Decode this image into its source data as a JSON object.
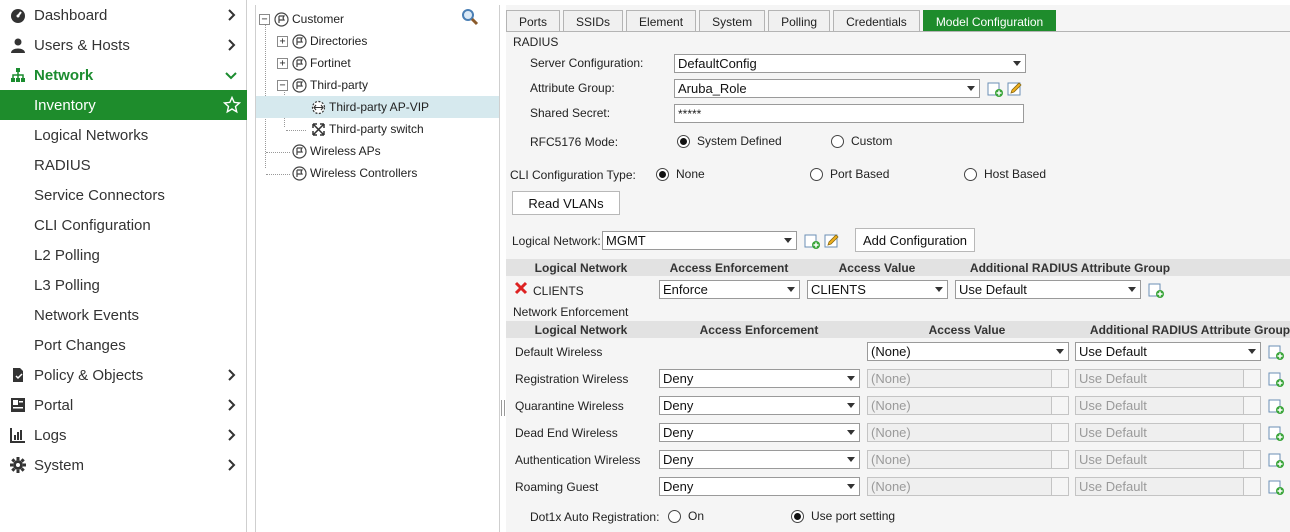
{
  "sidebar": {
    "items": [
      {
        "label": "Dashboard",
        "icon": "dashboard-icon"
      },
      {
        "label": "Users & Hosts",
        "icon": "user-icon"
      },
      {
        "label": "Network",
        "icon": "network-icon"
      },
      {
        "label": "Inventory"
      },
      {
        "label": "Logical Networks"
      },
      {
        "label": "RADIUS"
      },
      {
        "label": "Service Connectors"
      },
      {
        "label": "CLI Configuration"
      },
      {
        "label": "L2 Polling"
      },
      {
        "label": "L3 Polling"
      },
      {
        "label": "Network Events"
      },
      {
        "label": "Port Changes"
      },
      {
        "label": "Policy & Objects",
        "icon": "policy-icon"
      },
      {
        "label": "Portal",
        "icon": "portal-icon"
      },
      {
        "label": "Logs",
        "icon": "logs-icon"
      },
      {
        "label": "System",
        "icon": "gear-icon"
      }
    ]
  },
  "tree": {
    "root": "Customer",
    "nodes": [
      "Directories",
      "Fortinet",
      "Third-party",
      "Third-party AP-VIP",
      "Third-party switch",
      "Wireless APs",
      "Wireless Controllers"
    ]
  },
  "tabs": [
    "Ports",
    "SSIDs",
    "Element",
    "System",
    "Polling",
    "Credentials",
    "Model Configuration"
  ],
  "radius": {
    "title": "RADIUS",
    "server_config_label": "Server Configuration:",
    "server_config_value": "DefaultConfig",
    "attr_group_label": "Attribute Group:",
    "attr_group_value": "Aruba_Role",
    "shared_secret_label": "Shared Secret:",
    "shared_secret_value": "*****",
    "rfc_label": "RFC5176 Mode:",
    "rfc_opt1": "System Defined",
    "rfc_opt2": "Custom"
  },
  "cli": {
    "label": "CLI Configuration Type:",
    "opt1": "None",
    "opt2": "Port Based",
    "opt3": "Host Based"
  },
  "read_vlans": "Read VLANs",
  "logical_network": {
    "label": "Logical Network:",
    "value": "MGMT",
    "add_button": "Add Configuration"
  },
  "table1": {
    "headers": [
      "Logical Network",
      "Access Enforcement",
      "Access Value",
      "Additional RADIUS Attribute Group"
    ],
    "rows": [
      {
        "network": "CLIENTS",
        "enforcement": "Enforce",
        "value": "CLIENTS",
        "group": "Use Default"
      }
    ]
  },
  "net_enforcement": {
    "title": "Network Enforcement",
    "headers": [
      "Logical Network",
      "Access Enforcement",
      "Access Value",
      "Additional RADIUS Attribute Group"
    ],
    "rows": [
      {
        "network": "Default Wireless",
        "enforcement": "",
        "value": "(None)",
        "group": "Use Default"
      },
      {
        "network": "Registration Wireless",
        "enforcement": "Deny",
        "value": "(None)",
        "group": "Use Default"
      },
      {
        "network": "Quarantine Wireless",
        "enforcement": "Deny",
        "value": "(None)",
        "group": "Use Default"
      },
      {
        "network": "Dead End Wireless",
        "enforcement": "Deny",
        "value": "(None)",
        "group": "Use Default"
      },
      {
        "network": "Authentication Wireless",
        "enforcement": "Deny",
        "value": "(None)",
        "group": "Use Default"
      },
      {
        "network": "Roaming Guest",
        "enforcement": "Deny",
        "value": "(None)",
        "group": "Use Default"
      }
    ]
  },
  "dot1x": {
    "label": "Dot1x Auto Registration:",
    "opt1": "On",
    "opt2": "Use port setting"
  },
  "colors": {
    "accent": "#1e8c2c",
    "selected_tree": "#d6e9ee"
  }
}
